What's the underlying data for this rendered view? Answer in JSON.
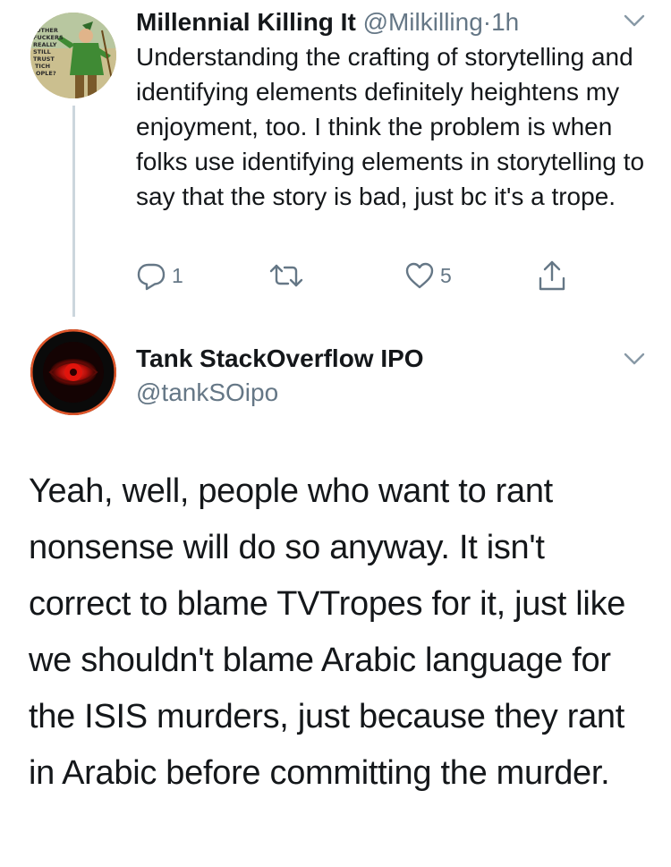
{
  "parent_tweet": {
    "display_name": "Millennial Killing It",
    "handle": "@Milkilling",
    "separator": "·",
    "timestamp": "1h",
    "text": "Understanding the crafting of storytelling and identifying elements definitely heightens my enjoyment, too. I think the problem is when folks use identifying elements in storytelling to say that the story is bad, just bc it's a trope.",
    "reply_count": "1",
    "like_count": "5",
    "avatar_text": [
      "OTHER",
      "FUCKERS",
      "REALLY",
      "STILL",
      "TRUST",
      "TICH",
      "OPLE?"
    ]
  },
  "reply_tweet": {
    "display_name": "Tank StackOverflow IPO",
    "handle": "@tankSOipo",
    "text": "Yeah, well, people who want to rant nonsense will do so anyway. It isn't correct to blame TVTropes for it, just like we shouldn't blame Arabic language for the ISIS murders, just because they rant in Arabic before committing the murder."
  },
  "icons": {
    "reply": "reply-icon",
    "retweet": "retweet-icon",
    "like": "heart-icon",
    "share": "share-icon",
    "menu": "chevron-down-icon"
  },
  "colors": {
    "text_primary": "#14171a",
    "text_secondary": "#657786",
    "thread_line": "#ccd6dd"
  }
}
